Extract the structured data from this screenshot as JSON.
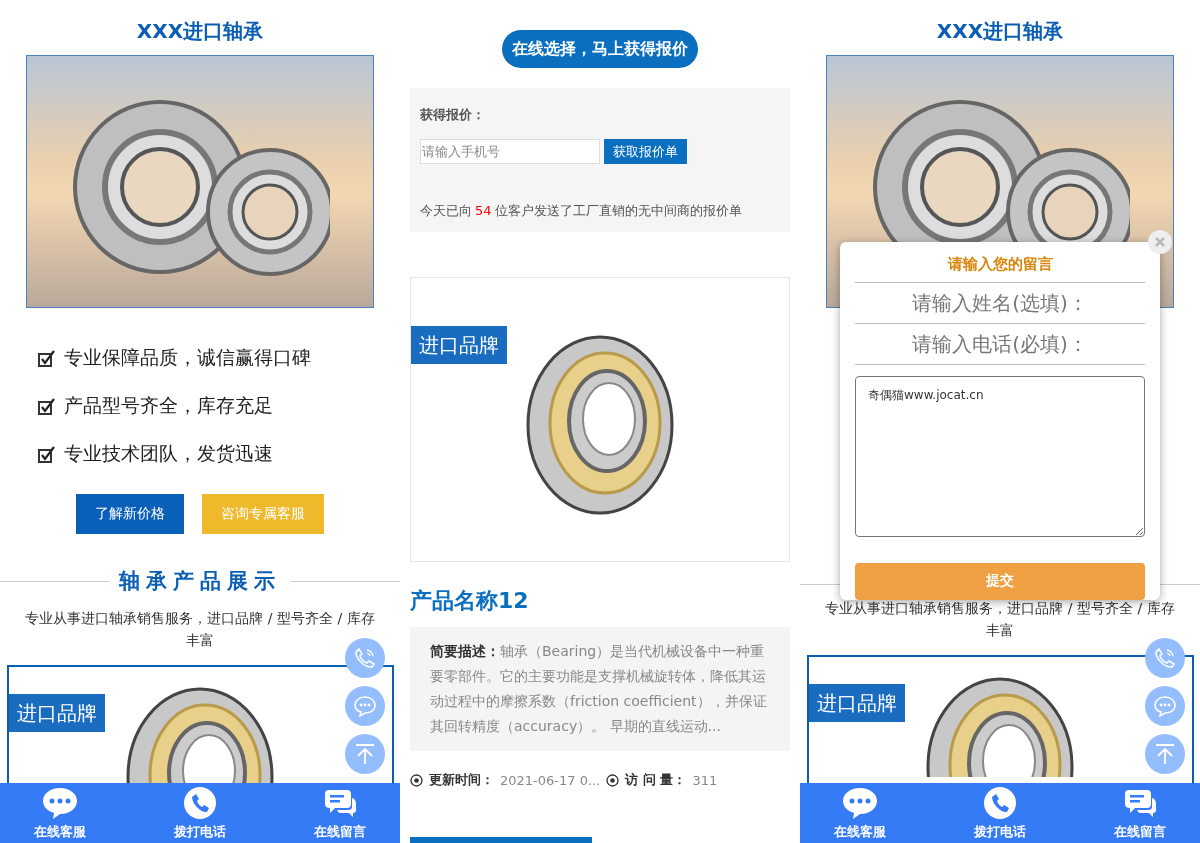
{
  "home_screen": {
    "title": "XXX进口轴承",
    "features": [
      "专业保障品质，诚信赢得口碑",
      "产品型号齐全，库存充足",
      "专业技术团队，发货迅速"
    ],
    "buttons": [
      {
        "label": "了解新价格",
        "kind": "primary"
      },
      {
        "label": "咨询专属客服",
        "kind": "accent"
      }
    ],
    "section_heading": "轴承产品展示",
    "section_subtitle": "专业从事进口轴承销售服务，进口品牌 / 型号齐全 / 库存丰富",
    "product_badge": "进口品牌",
    "nav": [
      {
        "label": "在线客服",
        "kind": "chat"
      },
      {
        "label": "拨打电话",
        "kind": "phone"
      },
      {
        "label": "在线留言",
        "kind": "message"
      }
    ]
  },
  "quote_screen": {
    "banner": "在线选择，马上获得报价",
    "quote_label": "获得报价：",
    "phone_placeholder": "请输入手机号",
    "quote_button": "获取报价单",
    "stat": {
      "before": "今天已向",
      "count": "54",
      "after": "位客户发送了工厂直销的无中间商的报价单"
    },
    "product_badge": "进口品牌",
    "product_title": "产品名称12",
    "description": "**简要描述：**轴承（Bearing）是当代机械设备中一种重要零部件。它的主要功能是支撑机械旋转体，降低其运动过程中的摩擦系数（friction coefficient），并保证其回转精度（accuracy）。 早期的直线运动...",
    "meta": [
      {
        "label": "更新时间：",
        "value": "2021-06-17 0..."
      },
      {
        "label": "访 问 量：",
        "value": "311"
      }
    ]
  },
  "message_screen": {
    "title": "XXX进口轴承",
    "dialog": {
      "title": "请输入您的留言",
      "name_placeholder": "请输入姓名(选填)：",
      "phone_placeholder": "请输入电话(必填)：",
      "message_value": "奇偶猫www.jocat.cn",
      "submit": "提交"
    },
    "section_subtitle": "专业从事进口轴承销售服务，进口品牌 / 型号齐全 / 库存丰富",
    "product_badge": "进口品牌",
    "nav": [
      {
        "label": "在线客服",
        "kind": "chat"
      },
      {
        "label": "拨打电话",
        "kind": "phone"
      },
      {
        "label": "在线留言",
        "kind": "message"
      }
    ]
  }
}
